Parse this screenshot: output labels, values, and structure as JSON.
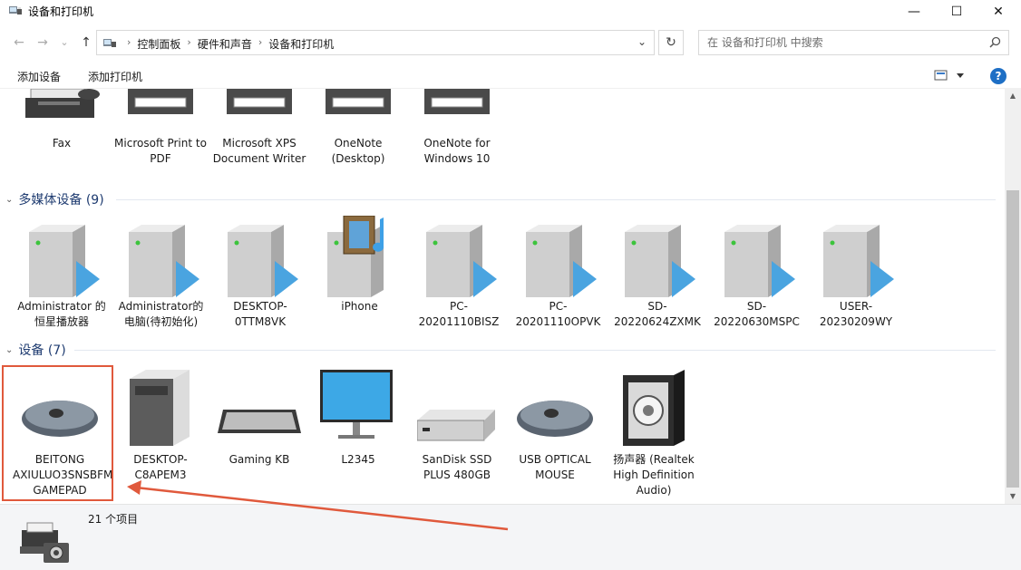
{
  "window": {
    "title": "设备和打印机",
    "minimize": "—",
    "maximize": "☐",
    "close": "✕"
  },
  "nav": {
    "back": "←",
    "forward": "→",
    "recent": "⌄",
    "up": "↑"
  },
  "address": {
    "crumbs": [
      "控制面板",
      "硬件和声音",
      "设备和打印机"
    ],
    "separator": "›",
    "dropdown": "⌄",
    "refresh": "↻"
  },
  "search": {
    "placeholder": "在 设备和打印机 中搜索"
  },
  "commands": {
    "add_device": "添加设备",
    "add_printer": "添加打印机",
    "help": "?"
  },
  "printers": [
    {
      "label": "Fax"
    },
    {
      "label": "Microsoft Print to PDF"
    },
    {
      "label": "Microsoft XPS Document Writer"
    },
    {
      "label": "OneNote (Desktop)"
    },
    {
      "label": "OneNote for Windows 10"
    }
  ],
  "groups": {
    "multimedia": {
      "title": "多媒体设备 (9)"
    },
    "devices": {
      "title": "设备 (7)"
    }
  },
  "multimedia": [
    {
      "label": "Administrator 的恒星播放器"
    },
    {
      "label": "Administrator的电脑(待初始化)"
    },
    {
      "label": "DESKTOP-0TTM8VK"
    },
    {
      "label": "iPhone"
    },
    {
      "label": "PC-20201110BISZ"
    },
    {
      "label": "PC-20201110OPVK"
    },
    {
      "label": "SD-20220624ZXMK"
    },
    {
      "label": "SD-20220630MSPC"
    },
    {
      "label": "USER-20230209WY"
    }
  ],
  "devices": [
    {
      "label": "BEITONG AXIULUO3SNSBFM GAMEPAD"
    },
    {
      "label": "DESKTOP-C8APEM3"
    },
    {
      "label": "Gaming KB"
    },
    {
      "label": "L2345"
    },
    {
      "label": "SanDisk SSD PLUS 480GB"
    },
    {
      "label": "USB OPTICAL MOUSE"
    },
    {
      "label": "扬声器 (Realtek High Definition Audio)"
    }
  ],
  "status": {
    "count": "21 个项目"
  },
  "colors": {
    "accent": "#1e6fc5",
    "group_header": "#1e3b70",
    "annotation": "#e0593c"
  }
}
